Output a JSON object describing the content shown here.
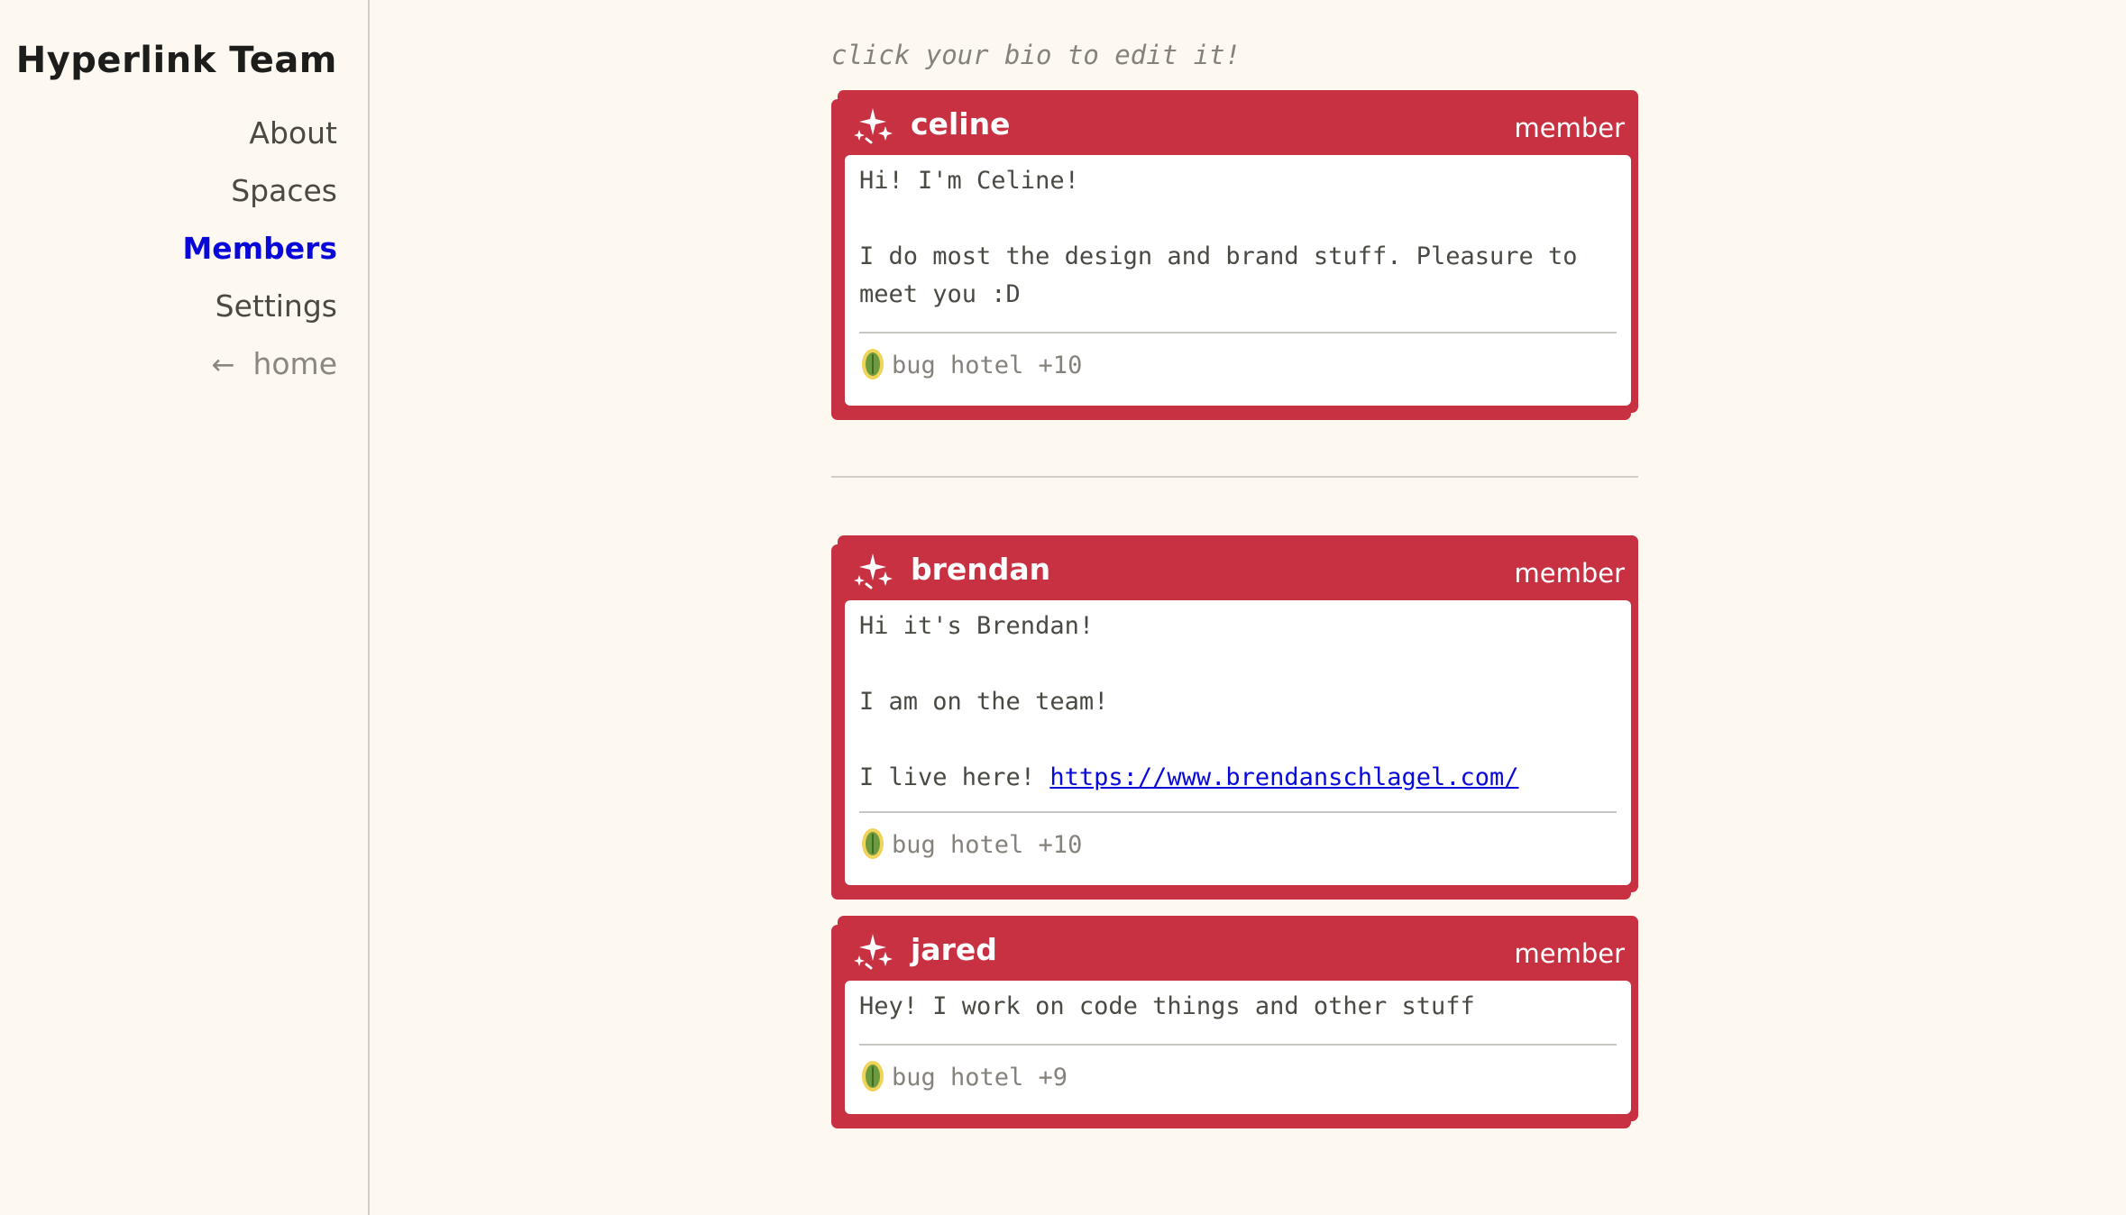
{
  "sidebar": {
    "title": "Hyperlink Team",
    "nav": [
      {
        "label": "About",
        "active": false
      },
      {
        "label": "Spaces",
        "active": false
      },
      {
        "label": "Members",
        "active": true
      },
      {
        "label": "Settings",
        "active": false
      }
    ],
    "home_label": "home",
    "home_icon": "arrow-left-icon"
  },
  "main": {
    "hint": "click your bio to edit it!",
    "members": [
      {
        "name": "celine",
        "role": "member",
        "bio": [
          "Hi! I'm Celine!",
          "",
          "I do most the design and brand stuff. Pleasure to meet you :D"
        ],
        "badge": "bug hotel +10"
      },
      {
        "name": "brendan",
        "role": "member",
        "bio": [
          "Hi it's Brendan!",
          "",
          "I am on the team!",
          ""
        ],
        "bio_link_prefix": "I live here! ",
        "bio_link": "https://www.brendanschlagel.com/",
        "badge": "bug hotel +10"
      },
      {
        "name": "jared",
        "role": "member",
        "bio": [
          "Hey! I work on code things and other stuff"
        ],
        "badge": "bug hotel +9"
      }
    ]
  },
  "colors": {
    "card_red": "#c83141",
    "active_link": "#0808d8",
    "background": "#fdf8f0"
  }
}
